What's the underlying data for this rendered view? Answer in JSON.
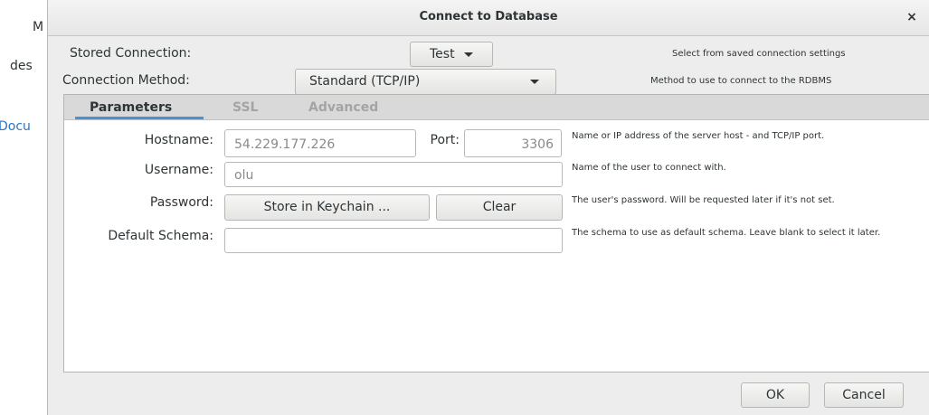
{
  "background": {
    "text_m": "M",
    "text_des": "des",
    "link_docu": "Docu"
  },
  "dialog": {
    "title": "Connect to Database",
    "close_glyph": "×",
    "stored_connection": {
      "label": "Stored Connection:",
      "value": "Test",
      "hint": "Select from saved connection settings"
    },
    "connection_method": {
      "label": "Connection Method:",
      "value": "Standard (TCP/IP)",
      "hint": "Method to use to connect to the RDBMS"
    },
    "tabs": [
      {
        "label": "Parameters",
        "active": true
      },
      {
        "label": "SSL",
        "active": false
      },
      {
        "label": "Advanced",
        "active": false
      }
    ],
    "parameters": {
      "hostname": {
        "label": "Hostname:",
        "value": "54.229.177.226",
        "hint": "Name or IP address of the server host - and TCP/IP port."
      },
      "port": {
        "label": "Port:",
        "value": "3306"
      },
      "username": {
        "label": "Username:",
        "value": "olu",
        "hint": "Name of the user to connect with."
      },
      "password": {
        "label": "Password:",
        "store_button": "Store in Keychain ...",
        "clear_button": "Clear",
        "hint": "The user's password. Will be requested later if it's not set."
      },
      "default_schema": {
        "label": "Default Schema:",
        "value": "",
        "hint": "The schema to use as default schema. Leave blank to select it later."
      }
    },
    "footer": {
      "ok_button": "OK",
      "cancel_button": "Cancel"
    }
  }
}
